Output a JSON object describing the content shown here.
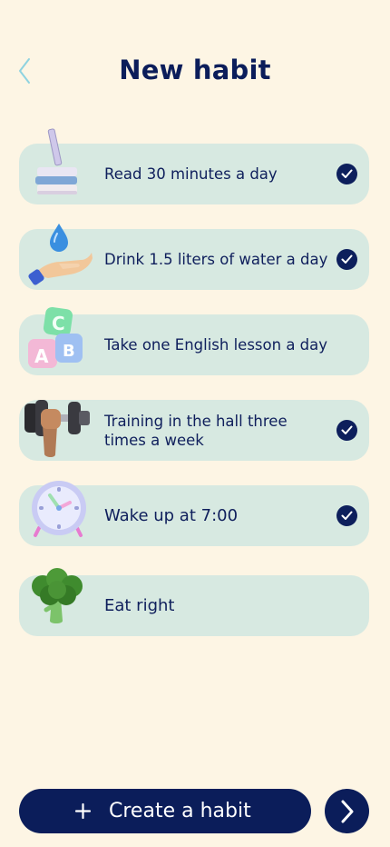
{
  "header": {
    "title": "New habit",
    "back_icon": "chevron-left-icon"
  },
  "habits": [
    {
      "label": "Read 30 minutes a day",
      "checked": true,
      "icon": "books-icon"
    },
    {
      "label": "Drink 1.5 liters of water a day",
      "checked": true,
      "icon": "water-hand-icon"
    },
    {
      "label": "Take one English lesson a day",
      "checked": false,
      "icon": "abc-blocks-icon"
    },
    {
      "label": "Training in the hall three times a week",
      "checked": true,
      "icon": "dumbbell-icon"
    },
    {
      "label": "Wake up at 7:00",
      "checked": true,
      "icon": "alarm-clock-icon"
    },
    {
      "label": "Eat right",
      "checked": false,
      "icon": "broccoli-icon"
    }
  ],
  "footer": {
    "create_label": "Create a habit",
    "create_icon": "plus-icon",
    "next_icon": "chevron-right-icon"
  },
  "colors": {
    "background": "#fdf5e4",
    "card": "#d7e9e1",
    "primary": "#0b1d5a",
    "back_arrow": "#8fd3e0"
  }
}
